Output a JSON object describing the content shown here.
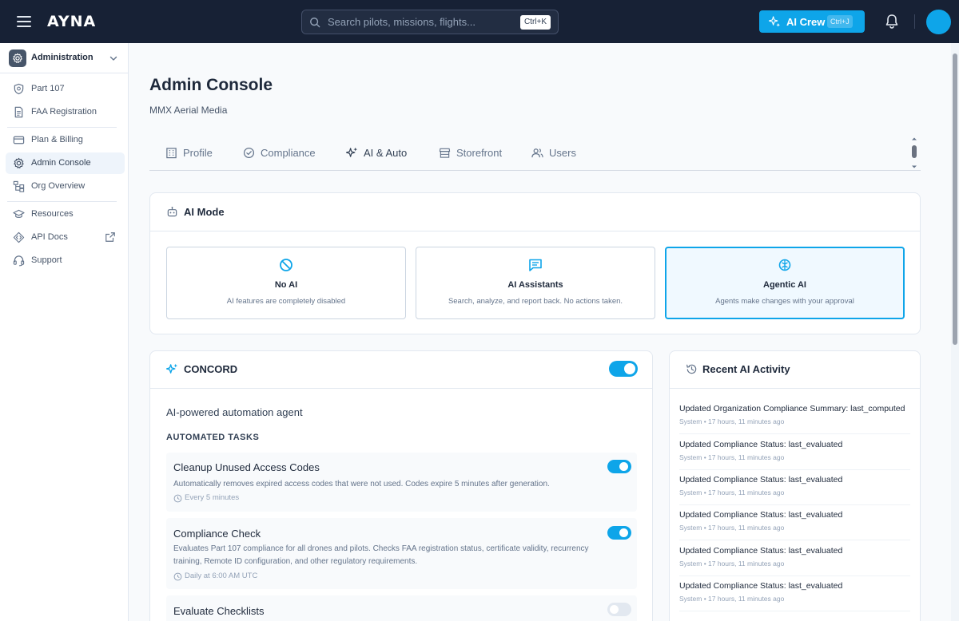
{
  "topbar": {
    "logo_text": "AYNA",
    "search": {
      "placeholder": "Search pilots, missions, flights...",
      "shortcut": "Ctrl+K"
    },
    "ai_crew": {
      "label": "AI Crew",
      "shortcut": "Ctrl+J"
    }
  },
  "sidebar": {
    "header": {
      "label": "Administration",
      "icon": "gear-icon"
    },
    "items": [
      {
        "label": "Part 107",
        "icon": "shield-icon"
      },
      {
        "label": "FAA Registration",
        "icon": "document-icon"
      },
      {
        "label": "Plan & Billing",
        "icon": "credit-card-icon"
      },
      {
        "label": "Admin Console",
        "icon": "gear-icon",
        "active": true
      },
      {
        "label": "Org Overview",
        "icon": "org-chart-icon"
      },
      {
        "label": "Resources",
        "icon": "graduation-cap-icon"
      },
      {
        "label": "API Docs",
        "icon": "code-icon",
        "external": true
      },
      {
        "label": "Support",
        "icon": "headset-icon"
      }
    ]
  },
  "page": {
    "title": "Admin Console",
    "subtitle": "MMX Aerial Media"
  },
  "tabs": [
    {
      "label": "Profile",
      "icon": "building-icon"
    },
    {
      "label": "Compliance",
      "icon": "check-circle-icon"
    },
    {
      "label": "AI & Auto",
      "icon": "sparkles-icon",
      "active": true
    },
    {
      "label": "Storefront",
      "icon": "store-icon"
    },
    {
      "label": "Users",
      "icon": "users-icon"
    }
  ],
  "ai_mode": {
    "title": "AI Mode",
    "options": [
      {
        "title": "No AI",
        "description": "AI features are completely disabled",
        "icon": "ban-icon"
      },
      {
        "title": "AI Assistants",
        "description": "Search, analyze, and report back. No actions taken.",
        "icon": "chat-icon"
      },
      {
        "title": "Agentic AI",
        "description": "Agents make changes with your approval",
        "icon": "brain-icon",
        "selected": true
      }
    ]
  },
  "concord": {
    "title": "CONCORD",
    "enabled": true,
    "description": "AI-powered automation agent",
    "tasks_heading": "AUTOMATED TASKS",
    "tasks": [
      {
        "title": "Cleanup Unused Access Codes",
        "description": "Automatically removes expired access codes that were not used. Codes expire 5 minutes after generation.",
        "schedule": "Every 5 minutes",
        "enabled": true
      },
      {
        "title": "Compliance Check",
        "description": "Evaluates Part 107 compliance for all drones and pilots. Checks FAA registration status, certificate validity, recurrency training, Remote ID configuration, and other regulatory requirements.",
        "schedule": "Daily at 6:00 AM UTC",
        "enabled": true
      },
      {
        "title": "Evaluate Checklists",
        "enabled": false
      }
    ]
  },
  "recent_activity": {
    "title": "Recent AI Activity",
    "items": [
      {
        "title": "Updated Organization Compliance Summary: last_computed",
        "meta": "System • 17 hours, 11 minutes ago"
      },
      {
        "title": "Updated Compliance Status: last_evaluated",
        "meta": "System • 17 hours, 11 minutes ago"
      },
      {
        "title": "Updated Compliance Status: last_evaluated",
        "meta": "System • 17 hours, 11 minutes ago"
      },
      {
        "title": "Updated Compliance Status: last_evaluated",
        "meta": "System • 17 hours, 11 minutes ago"
      },
      {
        "title": "Updated Compliance Status: last_evaluated",
        "meta": "System • 17 hours, 11 minutes ago"
      },
      {
        "title": "Updated Compliance Status: last_evaluated",
        "meta": "System • 17 hours, 11 minutes ago"
      }
    ]
  },
  "colors": {
    "topbar": "#172135",
    "accent": "#0ea5e9",
    "page_bg": "#f8fafc"
  }
}
